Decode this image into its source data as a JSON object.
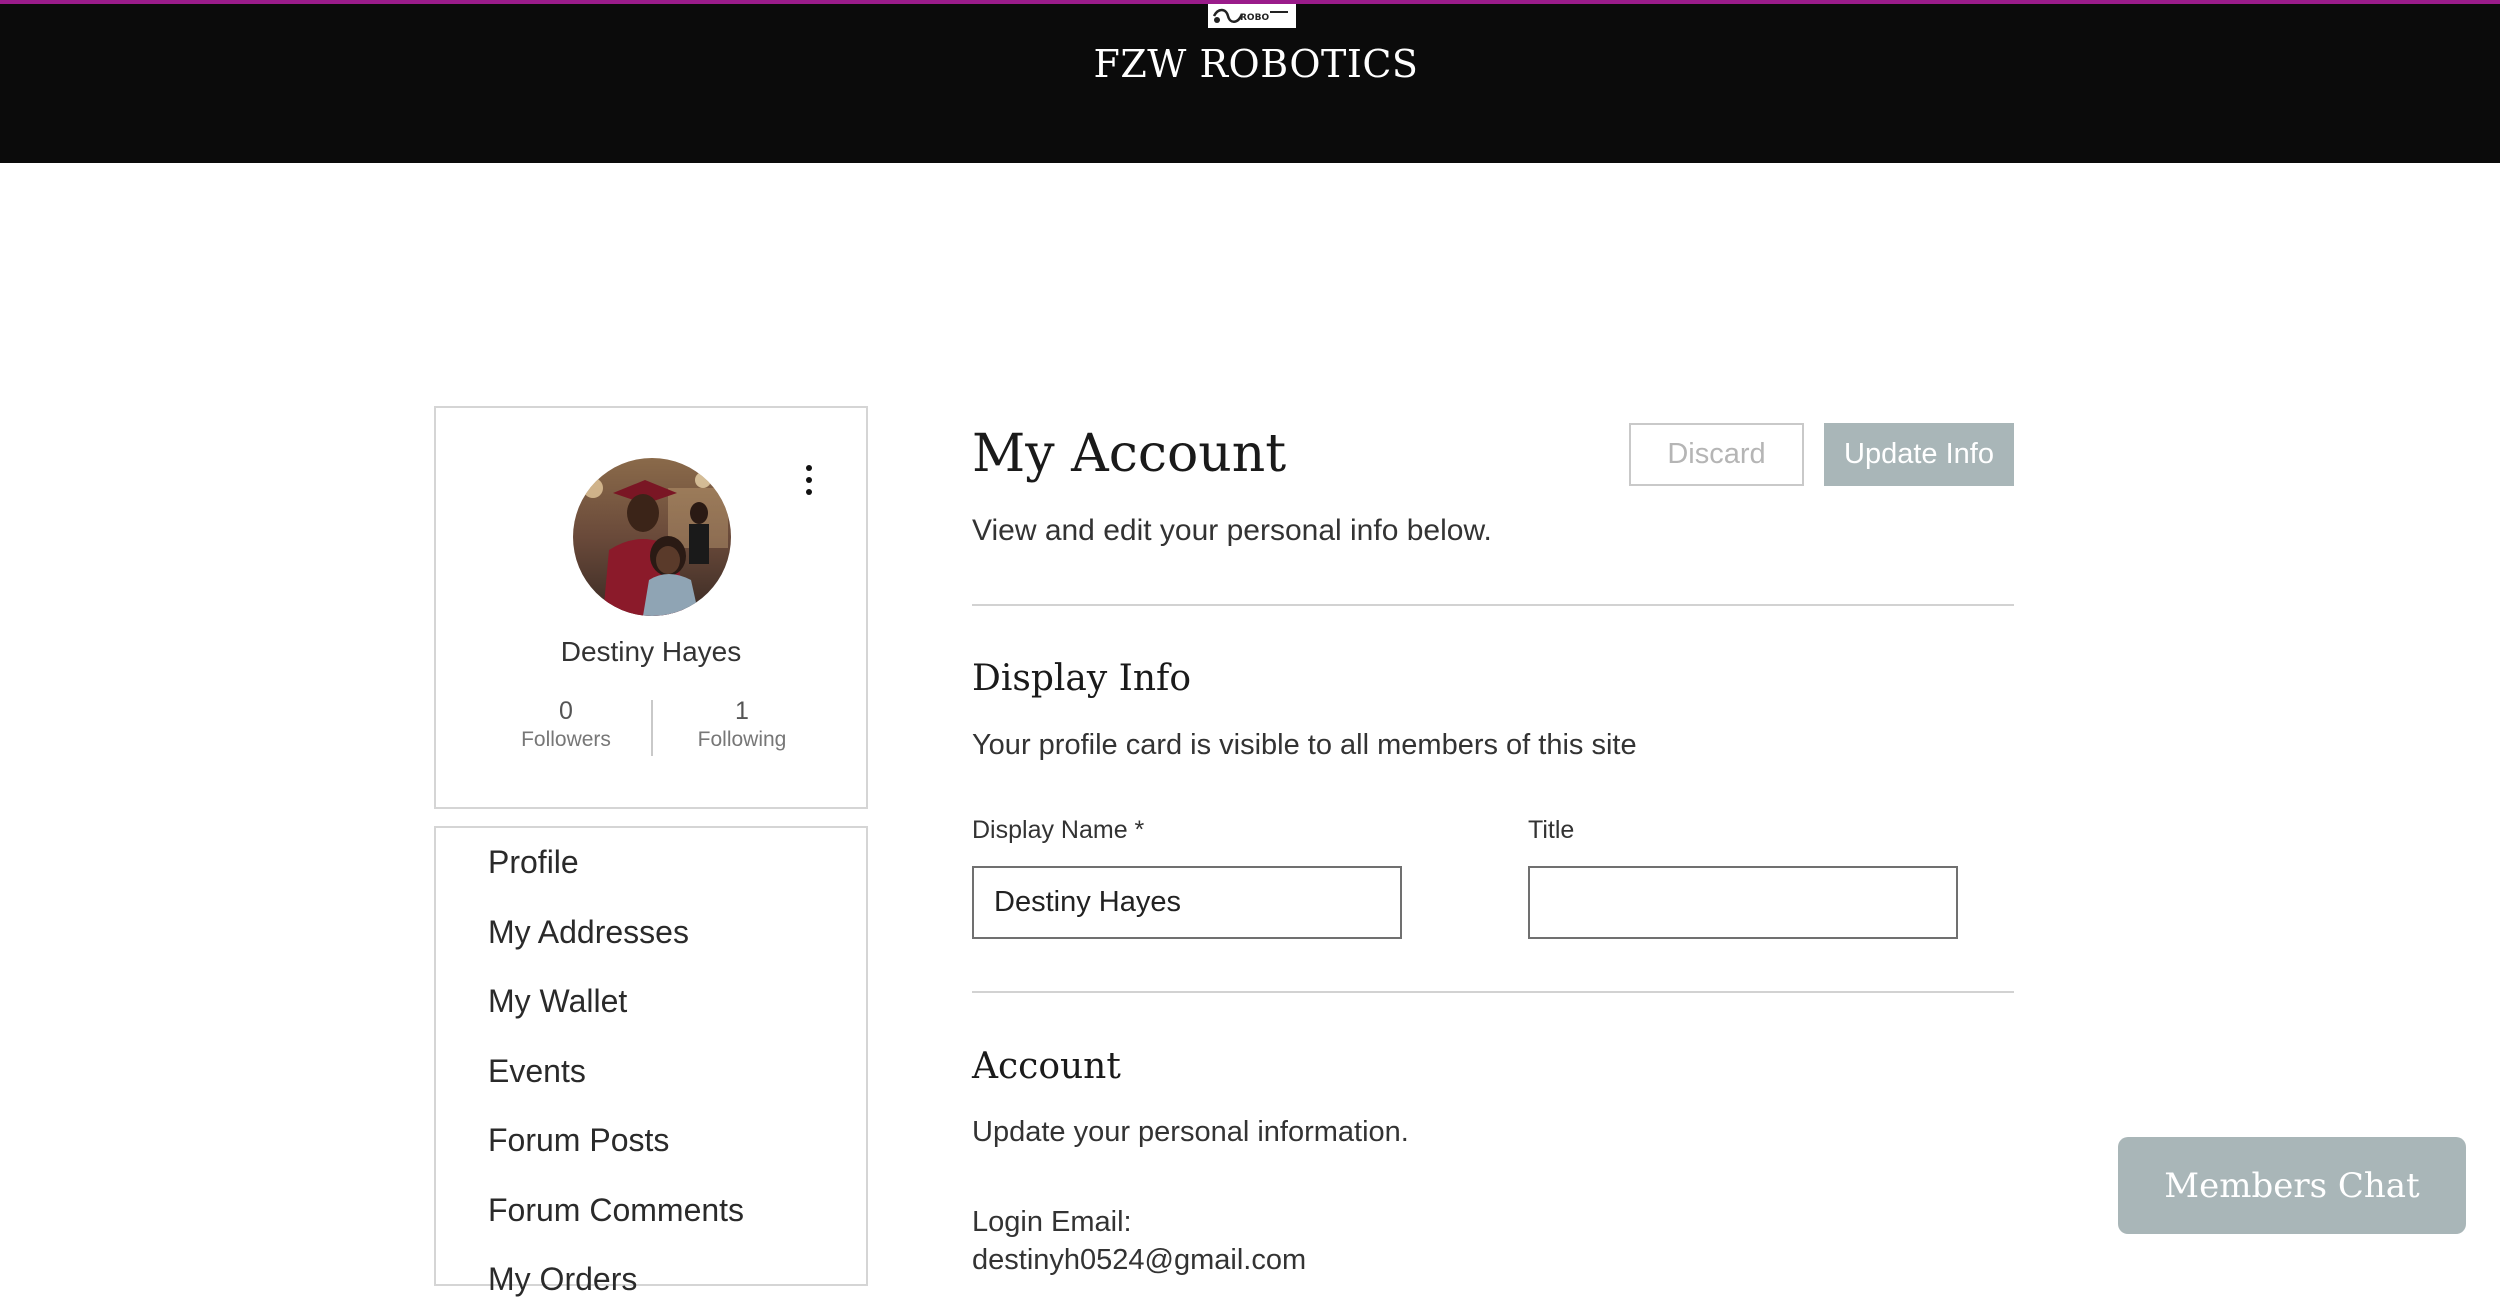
{
  "header": {
    "site_title": "FZW ROBOTICS",
    "accent_stripe_color": "#9a1c8a",
    "background_color": "#0b0b0b"
  },
  "profile": {
    "name": "Destiny Hayes",
    "followers_count": "0",
    "followers_label": "Followers",
    "following_count": "1",
    "following_label": "Following"
  },
  "nav": {
    "items": [
      {
        "label": "Profile"
      },
      {
        "label": "My Addresses"
      },
      {
        "label": "My Wallet"
      },
      {
        "label": "Events"
      },
      {
        "label": "Forum Posts"
      },
      {
        "label": "Forum Comments"
      },
      {
        "label": "My Orders"
      }
    ]
  },
  "main": {
    "title": "My Account",
    "subtitle": "View and edit your personal info below.",
    "discard_label": "Discard",
    "update_label": "Update Info",
    "display_info": {
      "title": "Display Info",
      "subtitle": "Your profile card is visible to all members of this site",
      "display_name_label": "Display Name *",
      "display_name_value": "Destiny Hayes",
      "title_label": "Title",
      "title_value": ""
    },
    "account": {
      "title": "Account",
      "subtitle": "Update your personal information.",
      "login_email_label": "Login Email:",
      "login_email_value": "destinyh0524@gmail.com"
    }
  },
  "chat": {
    "label": "Members Chat",
    "color": "#a9b6b8"
  }
}
